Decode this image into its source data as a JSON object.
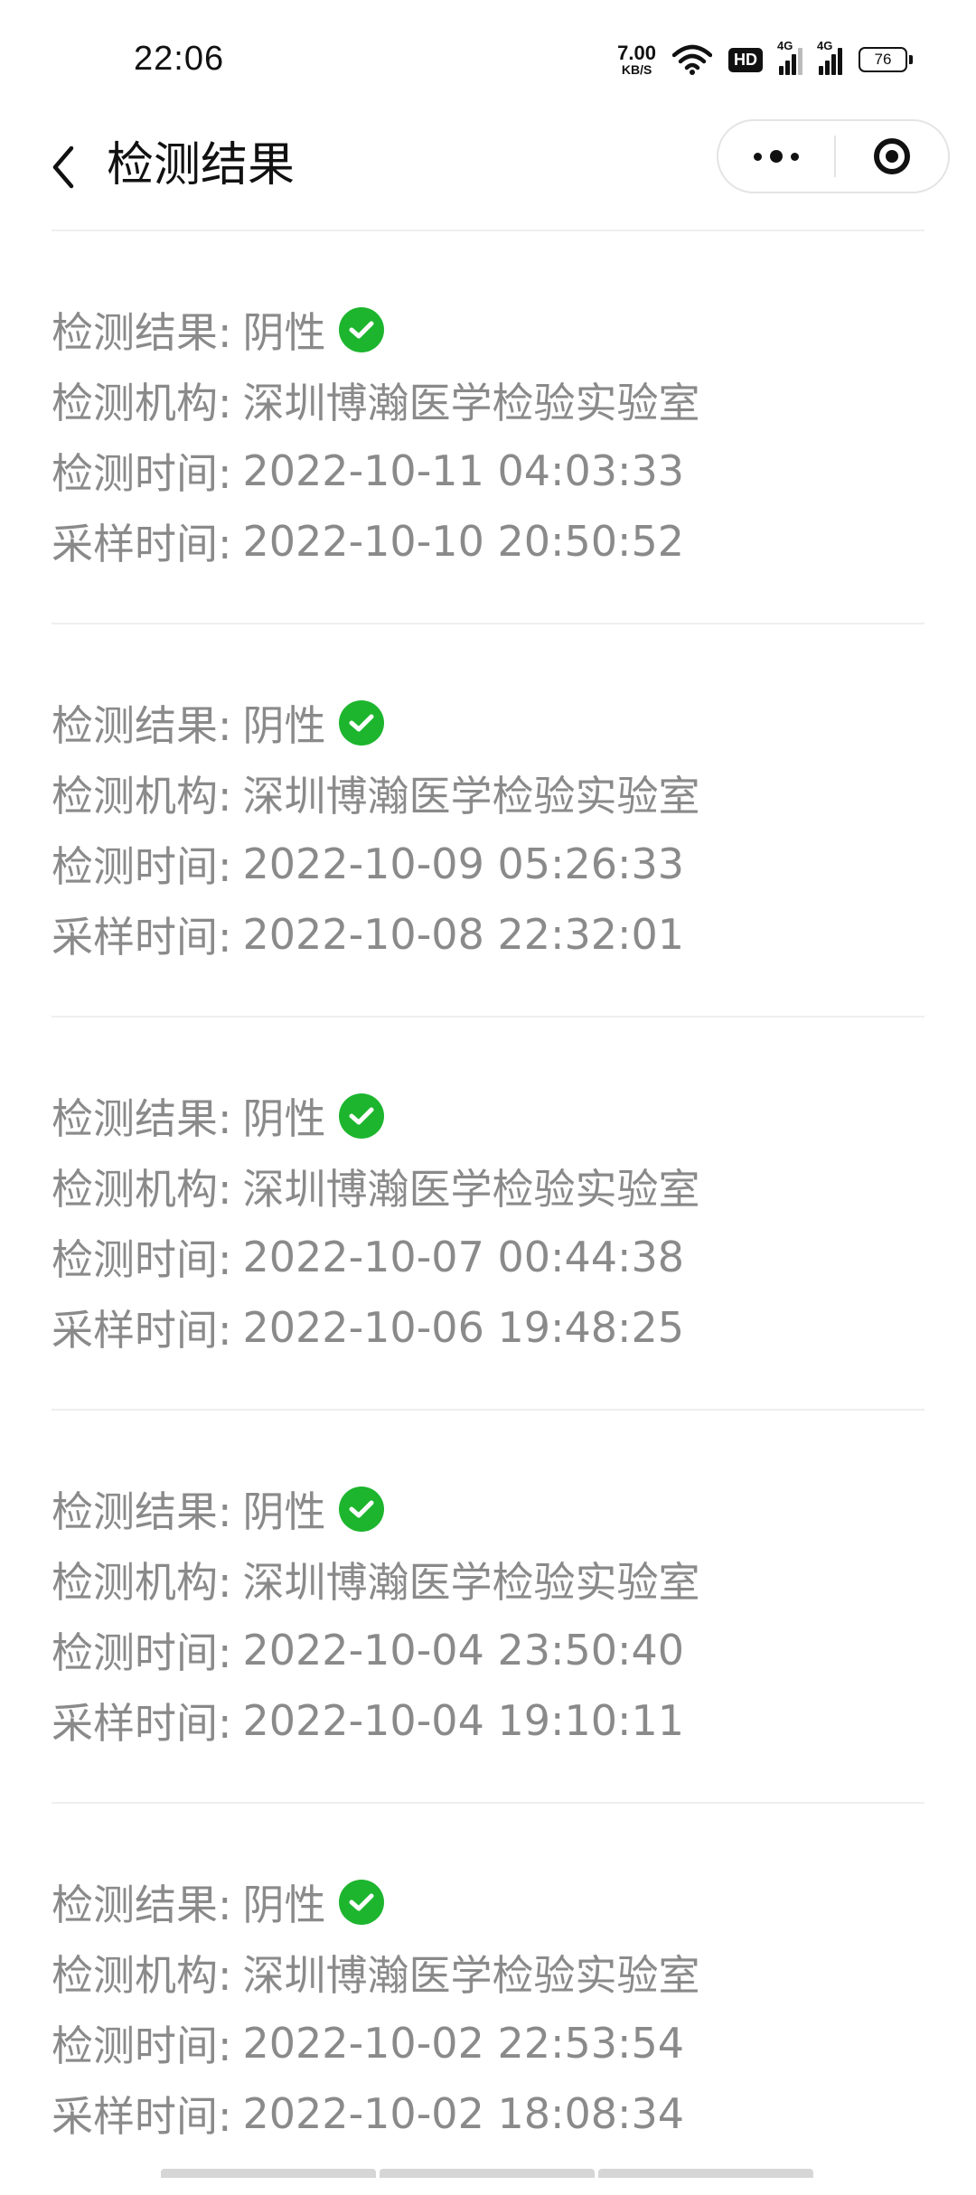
{
  "status_bar": {
    "time": "22:06",
    "net_speed_value": "7.00",
    "net_speed_unit": "KB/S",
    "hd_label": "HD",
    "signal_tag_1": "4G",
    "signal_tag_2": "4G",
    "battery": "76"
  },
  "nav": {
    "title": "检测结果"
  },
  "records": [
    {
      "result_label": "检测结果:",
      "result_value": "阴性",
      "org_label": "检测机构:",
      "org_value": "深圳博瀚医学检验实验室",
      "test_time_label": "检测时间:",
      "test_time_value": "2022-10-11 04:03:33",
      "sample_time_label": "采样时间:",
      "sample_time_value": "2022-10-10 20:50:52"
    },
    {
      "result_label": "检测结果:",
      "result_value": "阴性",
      "org_label": "检测机构:",
      "org_value": "深圳博瀚医学检验实验室",
      "test_time_label": "检测时间:",
      "test_time_value": "2022-10-09 05:26:33",
      "sample_time_label": "采样时间:",
      "sample_time_value": "2022-10-08 22:32:01"
    },
    {
      "result_label": "检测结果:",
      "result_value": "阴性",
      "org_label": "检测机构:",
      "org_value": "深圳博瀚医学检验实验室",
      "test_time_label": "检测时间:",
      "test_time_value": "2022-10-07 00:44:38",
      "sample_time_label": "采样时间:",
      "sample_time_value": "2022-10-06 19:48:25"
    },
    {
      "result_label": "检测结果:",
      "result_value": "阴性",
      "org_label": "检测机构:",
      "org_value": "深圳博瀚医学检验实验室",
      "test_time_label": "检测时间:",
      "test_time_value": "2022-10-04 23:50:40",
      "sample_time_label": "采样时间:",
      "sample_time_value": "2022-10-04 19:10:11"
    },
    {
      "result_label": "检测结果:",
      "result_value": "阴性",
      "org_label": "检测机构:",
      "org_value": "深圳博瀚医学检验实验室",
      "test_time_label": "检测时间:",
      "test_time_value": "2022-10-02 22:53:54",
      "sample_time_label": "采样时间:",
      "sample_time_value": "2022-10-02 18:08:34"
    }
  ],
  "colors": {
    "check_green": "#1db52e",
    "text_gray": "#8a8a8a",
    "divider": "#efefef"
  },
  "icons": {
    "back": "chevron-left-icon",
    "more": "more-dots-icon",
    "close": "target-ring-icon",
    "check": "check-circle-icon"
  }
}
